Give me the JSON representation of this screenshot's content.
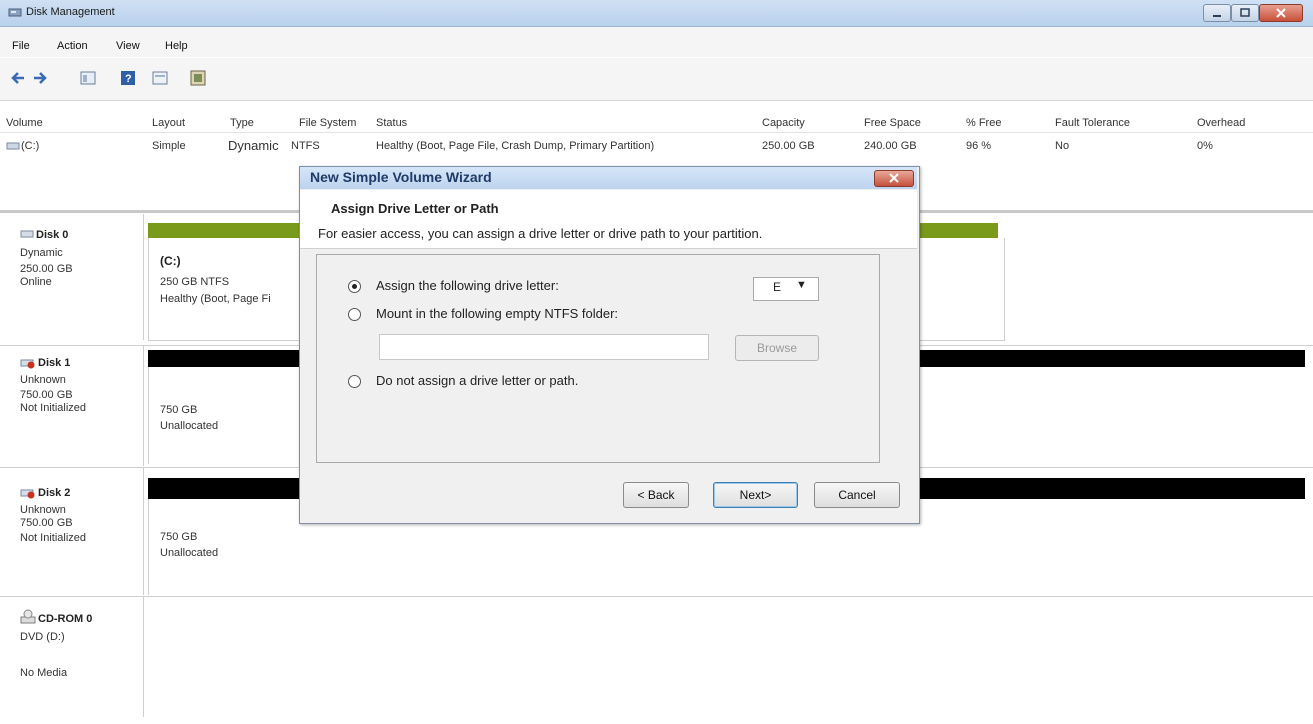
{
  "window": {
    "title": "Disk Management"
  },
  "menu": [
    "File",
    "Action",
    "View",
    "Help"
  ],
  "volume_list": {
    "columns": [
      "Volume",
      "Layout",
      "Type",
      "File System",
      "Status",
      "Capacity",
      "Free Space",
      "% Free",
      "Fault Tolerance",
      "Overhead"
    ],
    "rows": [
      {
        "volume": "(C:)",
        "layout": "Simple",
        "type": "Dynamic",
        "file_system": "NTFS",
        "status": "Healthy (Boot, Page File, Crash Dump, Primary Partition)",
        "capacity": "250.00 GB",
        "free_space": "240.00 GB",
        "pct_free": "96 %",
        "fault_tolerance": "No",
        "overhead": "0%"
      }
    ]
  },
  "disks": [
    {
      "name": "Disk 0",
      "kind": "Dynamic",
      "size": "250.00 GB",
      "state": "Online",
      "bar_color": "#7a9a1c",
      "partition": {
        "title": "(C:)",
        "line1": "250 GB NTFS",
        "line2": "Healthy (Boot, Page Fi"
      }
    },
    {
      "name": "Disk 1",
      "kind": "Unknown",
      "size": "750.00 GB",
      "state": "Not Initialized",
      "bar_color": "#000000",
      "partition": {
        "line1": "750 GB",
        "line2": "Unallocated"
      }
    },
    {
      "name": "Disk 2",
      "kind": "Unknown",
      "size": "750.00 GB",
      "state": "Not Initialized",
      "bar_color": "#000000",
      "partition": {
        "line1": "750 GB",
        "line2": "Unallocated"
      }
    },
    {
      "name": "CD-ROM 0",
      "kind": "DVD (D:)",
      "state": "No Media"
    }
  ],
  "dialog": {
    "title": "New Simple Volume Wizard",
    "heading": "Assign Drive Letter or Path",
    "description": "For easier access, you can assign a drive letter or drive path to your partition.",
    "options": [
      {
        "label": "Assign the following drive letter:",
        "selected": true
      },
      {
        "label": "Mount in the following empty NTFS folder:",
        "selected": false
      },
      {
        "label": "Do not assign a drive letter or path.",
        "selected": false
      }
    ],
    "drive_letter": "E",
    "folder_value": "",
    "browse_label": "Browse",
    "back_label": "< Back",
    "next_label": "Next>",
    "cancel_label": "Cancel"
  }
}
